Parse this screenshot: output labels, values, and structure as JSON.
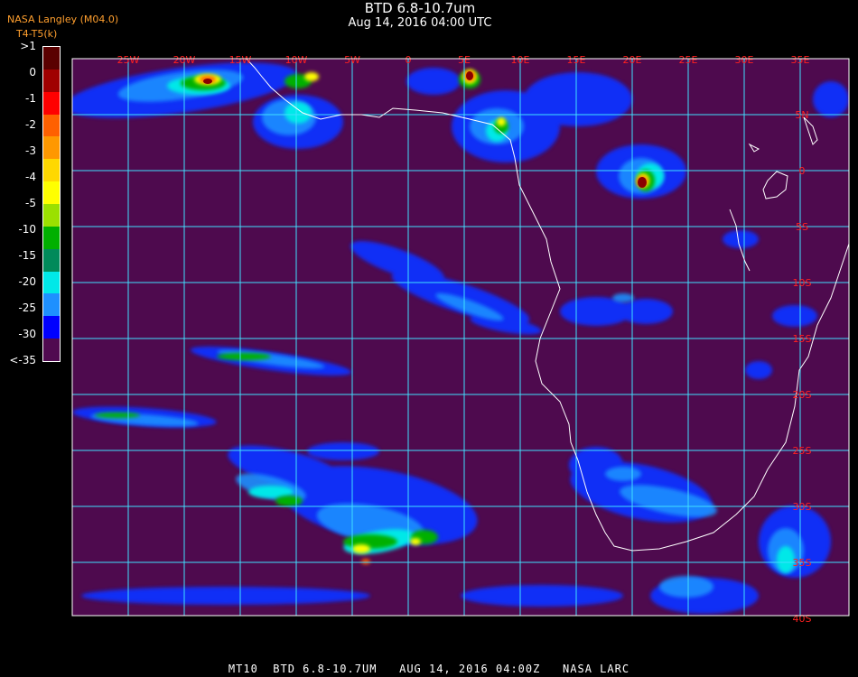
{
  "header": {
    "title": "BTD 6.8-10.7um",
    "subtitle": "Aug 14, 2016 04:00 UTC",
    "agency": "NASA Langley (M04.0)",
    "units": "T4-T5(k)"
  },
  "legend": {
    "labels": [
      ">1",
      "0",
      "-1",
      "-2",
      "-3",
      "-4",
      "-5",
      "-10",
      "-15",
      "-20",
      "-25",
      "-30",
      "<-35"
    ],
    "colors": [
      "#5a0000",
      "#a00000",
      "#ff0000",
      "#ff6000",
      "#ff9800",
      "#ffd800",
      "#ffff00",
      "#9be000",
      "#00b000",
      "#008a5a",
      "#00e8e8",
      "#1e90ff",
      "#0000ff",
      "#500a50"
    ]
  },
  "map": {
    "background_color": "#4e0a4e",
    "grid_color": "#40e0ff",
    "label_color": "#ff2020",
    "lon_labels": [
      "25W",
      "20W",
      "15W",
      "10W",
      "5W",
      "0",
      "5E",
      "10E",
      "15E",
      "20E",
      "25E",
      "30E",
      "35E"
    ],
    "lat_labels": [
      "5N",
      "0",
      "5S",
      "10S",
      "15S",
      "20S",
      "25S",
      "30S",
      "35S",
      "40S"
    ]
  },
  "footer": {
    "text": "MT10  BTD 6.8-10.7UM   AUG 14, 2016 04:00Z   NASA LARC"
  }
}
